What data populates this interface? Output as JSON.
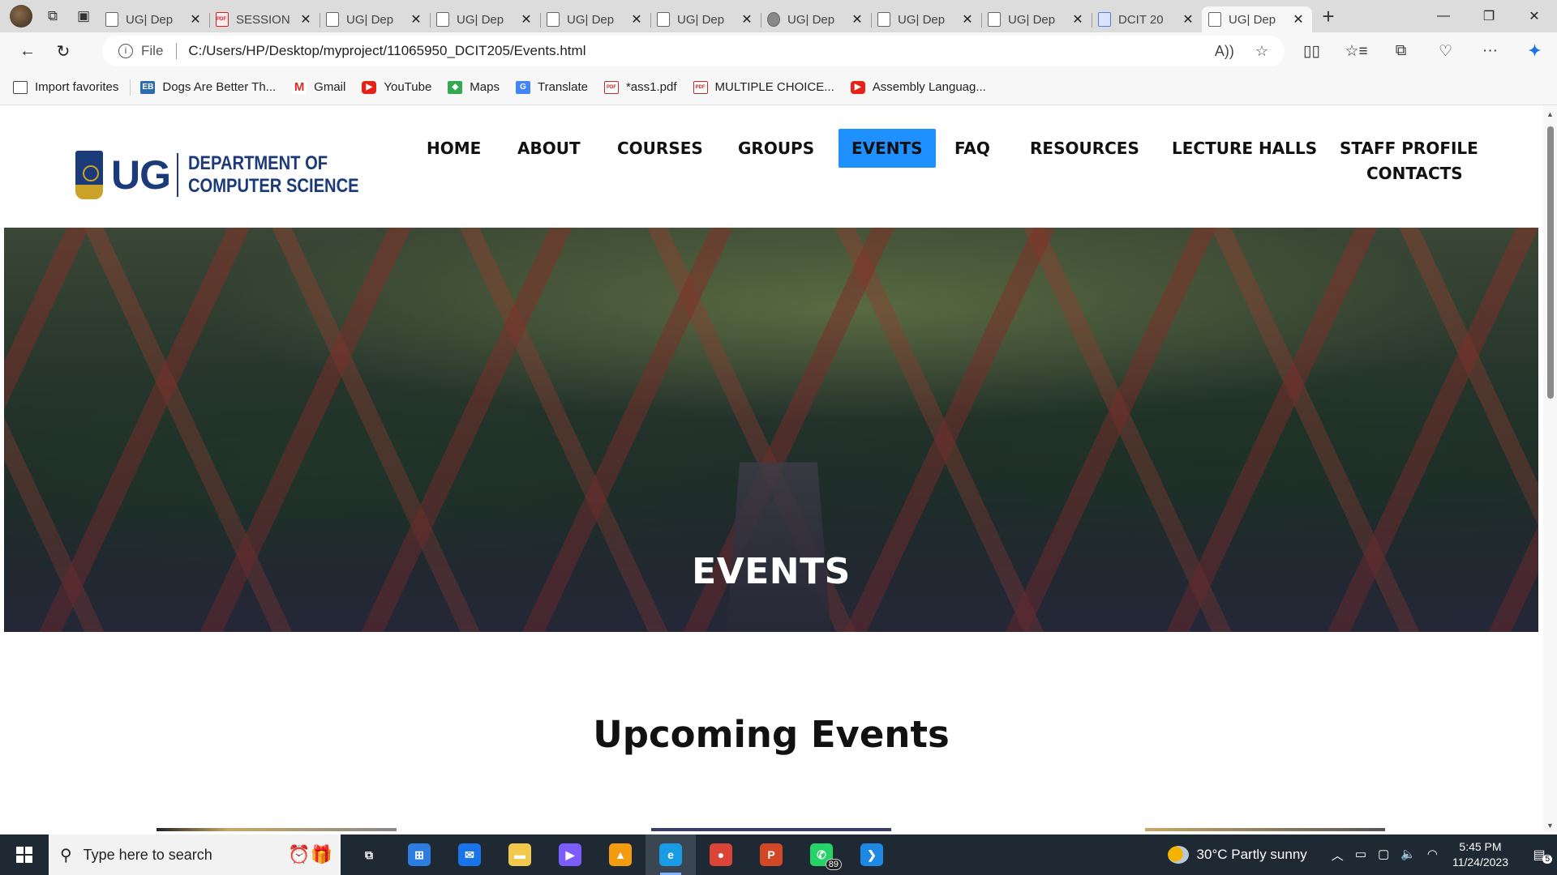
{
  "browser": {
    "tabs": [
      {
        "title": "UG| Dep",
        "icon": "page-icon"
      },
      {
        "title": "SESSION",
        "icon": "pdf-icon"
      },
      {
        "title": "UG| Dep",
        "icon": "page-icon"
      },
      {
        "title": "UG| Dep",
        "icon": "page-icon"
      },
      {
        "title": "UG| Dep",
        "icon": "page-icon"
      },
      {
        "title": "UG| Dep",
        "icon": "page-icon"
      },
      {
        "title": "UG| Dep",
        "icon": "globe-icon"
      },
      {
        "title": "UG| Dep",
        "icon": "page-icon"
      },
      {
        "title": "UG| Dep",
        "icon": "page-icon"
      },
      {
        "title": "DCIT 20",
        "icon": "doc-icon"
      },
      {
        "title": "UG| Dep",
        "icon": "page-icon",
        "active": true
      }
    ],
    "address": {
      "scheme_label": "File",
      "url": "C:/Users/HP/Desktop/myproject/11065950_DCIT205/Events.html"
    },
    "favorites": [
      {
        "label": "Import favorites",
        "icon": "import-icon"
      },
      {
        "label": "Dogs Are Better Th...",
        "icon": "eb-icon",
        "badge": "EB"
      },
      {
        "label": "Gmail",
        "icon": "gmail-icon",
        "badge": "M"
      },
      {
        "label": "YouTube",
        "icon": "youtube-icon",
        "badge": "▶"
      },
      {
        "label": "Maps",
        "icon": "maps-icon",
        "badge": "◆"
      },
      {
        "label": "Translate",
        "icon": "translate-icon",
        "badge": "G"
      },
      {
        "label": "*ass1.pdf",
        "icon": "pdf-icon",
        "badge": "PDF"
      },
      {
        "label": "MULTIPLE CHOICE...",
        "icon": "pdf-icon",
        "badge": "PDF"
      },
      {
        "label": "Assembly Languag...",
        "icon": "youtube-icon",
        "badge": "▶"
      }
    ]
  },
  "site": {
    "logo": {
      "mark": "UG",
      "dept_line1": "DEPARTMENT OF",
      "dept_line2": "COMPUTER SCIENCE"
    },
    "nav": [
      "HOME",
      "ABOUT",
      "COURSES",
      "GROUPS",
      "EVENTS",
      "FAQ",
      "RESOURCES",
      "LECTURE HALLS",
      "STAFF PROFILE",
      "CONTACTS"
    ],
    "active_nav": "EVENTS",
    "hero_title": "EVENTS",
    "section_title": "Upcoming Events",
    "colors": {
      "brand_navy": "#1b3a7a",
      "active_nav_bg": "#1e90ff",
      "crest_gold": "#c9a227"
    }
  },
  "taskbar": {
    "search_placeholder": "Type here to search",
    "apps": [
      {
        "name": "task-view",
        "glyph": "⧉"
      },
      {
        "name": "microsoft-store",
        "glyph": "⊞",
        "color": "#2d7de0"
      },
      {
        "name": "mail",
        "glyph": "✉",
        "color": "#1a73e8"
      },
      {
        "name": "file-explorer",
        "glyph": "▬",
        "color": "#f2c94c"
      },
      {
        "name": "clipchamp",
        "glyph": "▶",
        "color": "#7b5cff"
      },
      {
        "name": "vlc",
        "glyph": "▲",
        "color": "#f39c12"
      },
      {
        "name": "edge",
        "glyph": "e",
        "color": "#1a9be6",
        "active": true
      },
      {
        "name": "chrome",
        "glyph": "●",
        "color": "#db4437"
      },
      {
        "name": "powerpoint",
        "glyph": "P",
        "color": "#d24726"
      },
      {
        "name": "whatsapp",
        "glyph": "✆",
        "color": "#25d366",
        "badge": "89"
      },
      {
        "name": "vscode",
        "glyph": "❯",
        "color": "#1e88e5"
      }
    ],
    "weather": {
      "temp": "30°C",
      "condition": "Partly sunny"
    },
    "time": "5:45 PM",
    "date": "11/24/2023",
    "notification_count": "5"
  }
}
